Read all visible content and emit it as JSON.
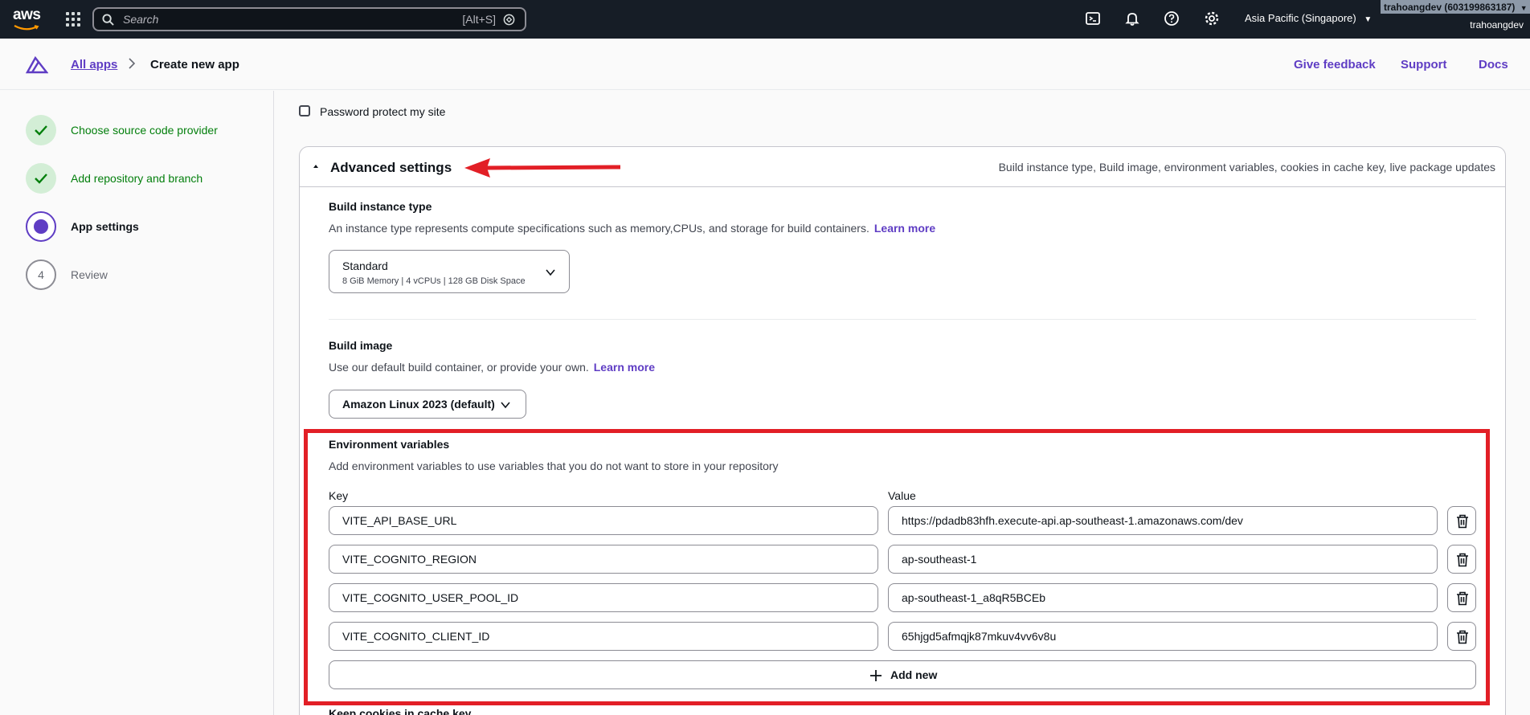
{
  "topnav": {
    "logo": "aws",
    "search_placeholder": "Search",
    "search_shortcut": "[Alt+S]",
    "region": "Asia Pacific (Singapore)",
    "account_badge": "trahoangdev (603199863187)",
    "account_name": "trahoangdev",
    "icons": [
      "services-grid-icon",
      "search-icon",
      "cloudshell-icon",
      "bell-icon",
      "help-icon",
      "settings-icon"
    ]
  },
  "header": {
    "breadcrumb_link": "All apps",
    "breadcrumb_current": "Create new app",
    "links": [
      "Give feedback",
      "Support",
      "Docs"
    ]
  },
  "steps": [
    {
      "label": "Choose source code provider",
      "state": "done"
    },
    {
      "label": "Add repository and branch",
      "state": "done"
    },
    {
      "label": "App settings",
      "state": "current"
    },
    {
      "label": "Review",
      "state": "pending",
      "number": "4"
    }
  ],
  "password_protect_label": "Password protect my site",
  "advanced": {
    "title": "Advanced settings",
    "description": "Build instance type, Build image, environment variables, cookies in cache key, live package updates",
    "build_instance": {
      "title": "Build instance type",
      "description": "An instance type represents compute specifications such as memory,CPUs, and storage for build containers.",
      "learn_more": "Learn more",
      "selected": "Standard",
      "selected_detail": "8 GiB Memory | 4 vCPUs | 128 GB Disk Space"
    },
    "build_image": {
      "title": "Build image",
      "description": "Use our default build container, or provide your own.",
      "learn_more": "Learn more",
      "selected": "Amazon Linux 2023 (default)"
    },
    "env": {
      "title": "Environment variables",
      "description": "Add environment variables to use variables that you do not want to store in your repository",
      "key_label": "Key",
      "value_label": "Value",
      "rows": [
        {
          "key": "VITE_API_BASE_URL",
          "value": "https://pdadb83hfh.execute-api.ap-southeast-1.amazonaws.com/dev"
        },
        {
          "key": "VITE_COGNITO_REGION",
          "value": "ap-southeast-1"
        },
        {
          "key": "VITE_COGNITO_USER_POOL_ID",
          "value": "ap-southeast-1_a8qR5BCEb"
        },
        {
          "key": "VITE_COGNITO_CLIENT_ID",
          "value": "65hjgd5afmqjk87mkuv4vv6v8u"
        }
      ],
      "add_new_label": "Add new"
    },
    "next_section_title": "Keep cookies in cache key"
  },
  "colors": {
    "nav_bg": "#161d26",
    "accent": "#5f3dc4",
    "success": "#037f0c",
    "annotation_red": "#e21f26"
  }
}
